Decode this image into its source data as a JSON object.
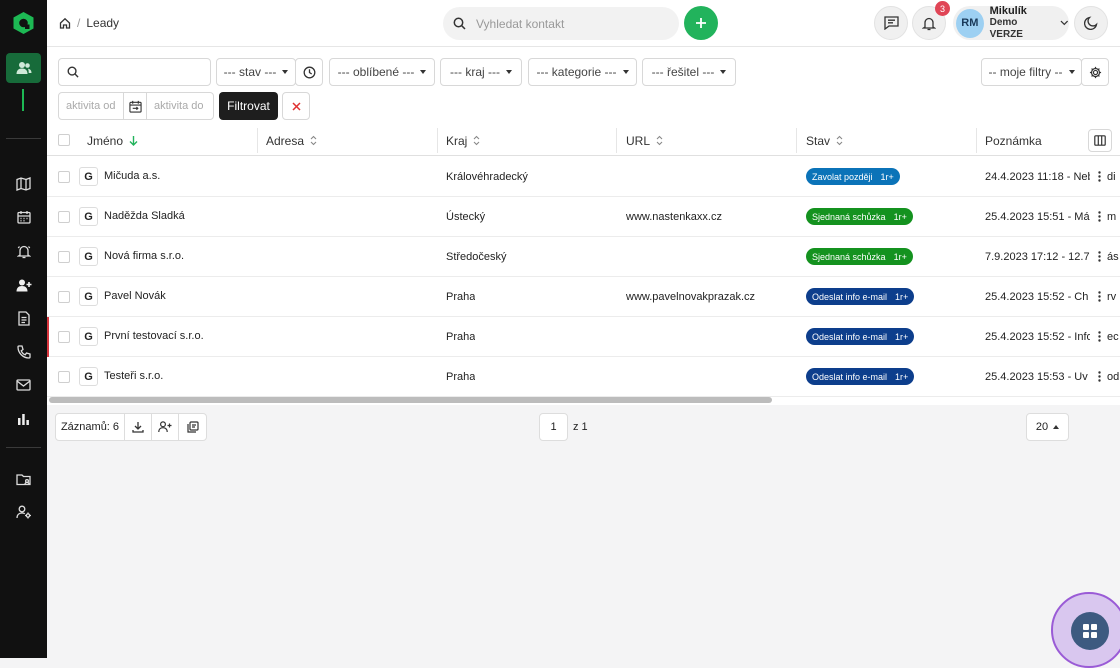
{
  "breadcrumb": {
    "page": "Leady"
  },
  "topbar": {
    "search_placeholder": "Vyhledat kontakt",
    "notifications_count": "3"
  },
  "user": {
    "initials": "RM",
    "name": "Mikulík",
    "subtitle": "Demo VERZE"
  },
  "filters": {
    "search_value": "",
    "status": "--- stav ---",
    "favorites": "--- oblíbené ---",
    "region": "--- kraj ---",
    "category": "--- kategorie ---",
    "solver": "--- řešitel ---",
    "my_filters": "-- moje filtry --",
    "activity_from_placeholder": "aktivita od",
    "activity_to_placeholder": "aktivita do",
    "filter_button": "Filtrovat"
  },
  "table": {
    "columns": [
      "Jméno",
      "Adresa",
      "Kraj",
      "URL",
      "Stav",
      "Poznámka"
    ],
    "rows": [
      {
        "name": "Mičuda a.s.",
        "address": "",
        "region": "Královéhradecký",
        "url": "",
        "status": "Zavolat později",
        "status_count": "1r+",
        "status_color": "#0b73b8",
        "note": "24.4.2023 11:18 - Neb",
        "note_edge": "di"
      },
      {
        "name": "Naděžda Sladká",
        "address": "",
        "region": "Ústecký",
        "url": "www.nastenkaxx.cz",
        "status": "Sjednaná schůzka",
        "status_count": "1r+",
        "status_color": "#14921f",
        "note": "25.4.2023 15:51 - Má",
        "note_edge": "m"
      },
      {
        "name": "Nová firma s.r.o.",
        "address": "",
        "region": "Středočeský",
        "url": "",
        "status": "Sjednaná schůzka",
        "status_count": "1r+",
        "status_color": "#14921f",
        "note": "7.9.2023 17:12 - 12.7 -",
        "note_edge": "ás"
      },
      {
        "name": "Pavel Novák",
        "address": "",
        "region": "Praha",
        "url": "www.pavelnovakprazak.cz",
        "status": "Odeslat info e-mail",
        "status_count": "1r+",
        "status_color": "#0d3e8c",
        "note": "25.4.2023 15:52 - Ch",
        "note_edge": "rv"
      },
      {
        "name": "První testovací s.r.o.",
        "address": "",
        "region": "Praha",
        "url": "",
        "status": "Odeslat info e-mail",
        "status_count": "1r+",
        "status_color": "#0d3e8c",
        "note": "25.4.2023 15:52 - Info",
        "note_edge": "ec"
      },
      {
        "name": "Testeři s.r.o.",
        "address": "",
        "region": "Praha",
        "url": "",
        "status": "Odeslat info e-mail",
        "status_count": "1r+",
        "status_color": "#0d3e8c",
        "note": "25.4.2023 15:53 - Uv",
        "note_edge": "od"
      }
    ]
  },
  "footer": {
    "records_label": "Záznamů: 6",
    "page": "1",
    "page_of": "z 1",
    "per_page": "20"
  },
  "colors": {
    "accent": "#22b35c",
    "sidebar_bg": "#111111",
    "sidebar_active": "#176b3a"
  },
  "icons": {
    "sidebar": [
      "users-icon",
      "map-icon",
      "calendar-icon",
      "bell-icon",
      "user-add-icon",
      "document-icon",
      "phone-icon",
      "mail-icon",
      "chart-icon",
      "folder-user-icon",
      "user-settings-icon"
    ]
  }
}
